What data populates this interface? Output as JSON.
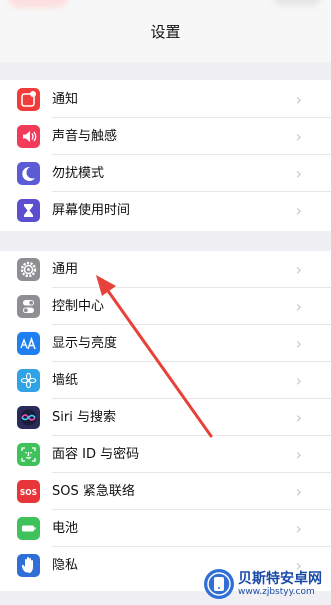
{
  "header": {
    "title": "设置"
  },
  "groups": [
    {
      "items": [
        {
          "label": "通知",
          "icon": "notifications-icon",
          "color": "#f23b3b"
        },
        {
          "label": "声音与触感",
          "icon": "sound-icon",
          "color": "#f23a5a"
        },
        {
          "label": "勿扰模式",
          "icon": "moon-icon",
          "color": "#5b5bd6"
        },
        {
          "label": "屏幕使用时间",
          "icon": "hourglass-icon",
          "color": "#5b4fcf"
        }
      ]
    },
    {
      "items": [
        {
          "label": "通用",
          "icon": "gear-icon",
          "color": "#8e8e93"
        },
        {
          "label": "控制中心",
          "icon": "toggles-icon",
          "color": "#8e8e93"
        },
        {
          "label": "显示与亮度",
          "icon": "display-aa-icon",
          "color": "#1f7ff0"
        },
        {
          "label": "墙纸",
          "icon": "wallpaper-flower-icon",
          "color": "#2fa3e6"
        },
        {
          "label": "Siri 与搜索",
          "icon": "siri-icon",
          "color": "#2b2b5a"
        },
        {
          "label": "面容 ID 与密码",
          "icon": "face-id-icon",
          "color": "#3fc25c"
        },
        {
          "label": "SOS 紧急联络",
          "icon": "sos-icon",
          "color": "#e8353a"
        },
        {
          "label": "电池",
          "icon": "battery-icon",
          "color": "#3fc25c"
        },
        {
          "label": "隐私",
          "icon": "hand-icon",
          "color": "#2f6fd6"
        }
      ]
    }
  ],
  "chevron": "›",
  "annotation": {
    "color": "#e8413a",
    "points_to": "通用"
  },
  "watermark": {
    "title": "贝斯特安卓网",
    "url": "www.zjbstyy.com"
  }
}
